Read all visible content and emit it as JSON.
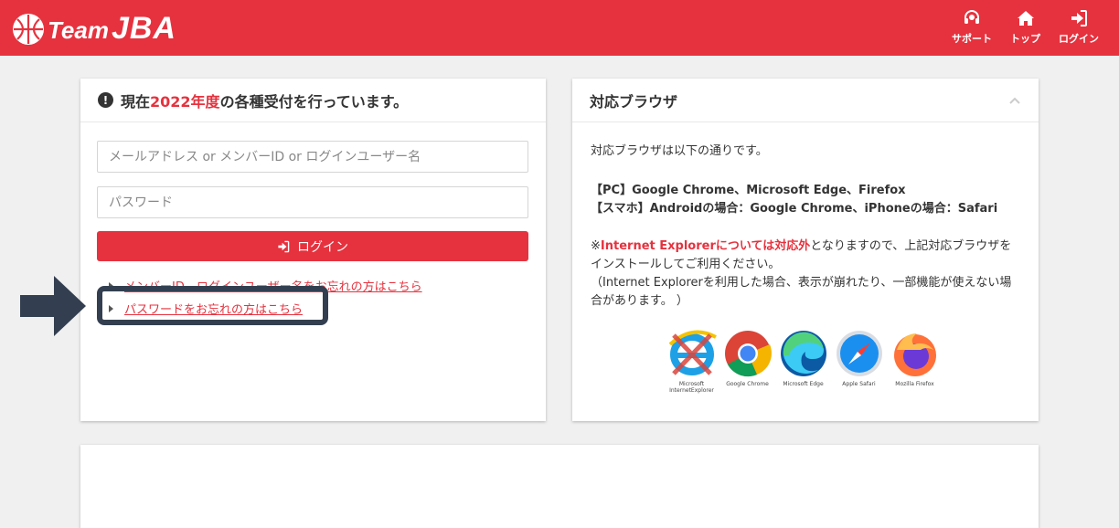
{
  "header": {
    "brand_team": "Team",
    "brand_jba": "JBA",
    "brand_color": "#e6323e",
    "nav": [
      {
        "label": "サポート",
        "icon": "headset-icon"
      },
      {
        "label": "トップ",
        "icon": "home-icon"
      },
      {
        "label": "ログイン",
        "icon": "sign-in-icon"
      }
    ]
  },
  "login": {
    "heading_prefix": "現在",
    "heading_year": "2022年度",
    "heading_suffix": "の各種受付を行っています。",
    "email_placeholder": "メールアドレス or メンバーID or ログインユーザー名",
    "password_placeholder": "パスワード",
    "login_button": "ログイン",
    "forgot_id_link": "メンバーID、ログインユーザー名をお忘れの方はこちら",
    "forgot_password_link": "パスワードをお忘れの方はこちら"
  },
  "browsers_card": {
    "title": "対応ブラウザ",
    "intro": "対応ブラウザは以下の通りです。",
    "pc_line": "【PC】Google Chrome、Microsoft Edge、Firefox",
    "sp_line": "【スマホ】Androidの場合：Google Chrome、iPhoneの場合：Safari",
    "ie_note_prefix": "※",
    "ie_note_red": "Internet Explorerについては対応外",
    "ie_note_rest": "となりますので、上記対応ブラウザをインストールしてご利用ください。",
    "ie_note_paren": "（Internet Explorerを利用した場合、表示が崩れたり、一部機能が使えない場合があります。 ）",
    "browsers": [
      {
        "line1": "Microsoft",
        "line2": "InternetExplorer"
      },
      {
        "line1": "Google Chrome",
        "line2": ""
      },
      {
        "line1": "Microsoft Edge",
        "line2": ""
      },
      {
        "line1": "Apple Safari",
        "line2": ""
      },
      {
        "line1": "Mozilla Firefox",
        "line2": ""
      }
    ]
  }
}
